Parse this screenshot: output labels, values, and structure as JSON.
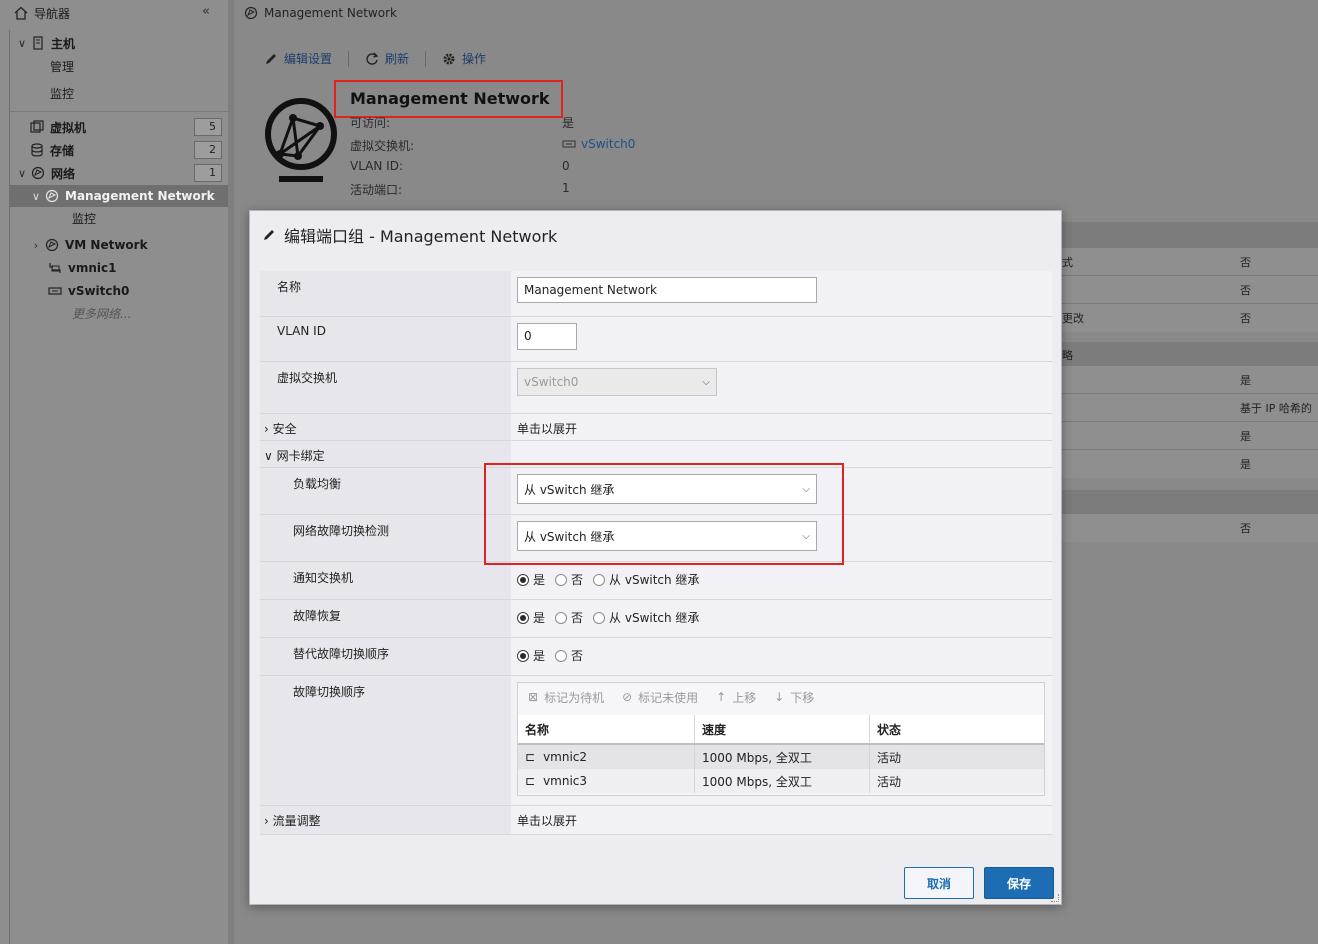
{
  "navigator": {
    "title": "导航器",
    "host": "主机",
    "host_manage": "管理",
    "host_monitor": "监控",
    "vms": "虚拟机",
    "vms_count": "5",
    "storage": "存储",
    "storage_count": "2",
    "network": "网络",
    "network_count": "1",
    "mgmt_network": "Management Network",
    "mgmt_monitor": "监控",
    "vm_network": "VM Network",
    "vmnic1": "vmnic1",
    "vswitch0": "vSwitch0",
    "more": "更多网络..."
  },
  "breadcrumb": "Management Network",
  "toolbar": {
    "edit": "编辑设置",
    "refresh": "刷新",
    "actions": "操作"
  },
  "summary": {
    "title": "Management Network",
    "accessible_label": "可访问:",
    "accessible_value": "是",
    "vswitch_label": "虚拟交换机:",
    "vswitch_value": "vSwitch0",
    "vlan_label": "VLAN ID:",
    "vlan_value": "0",
    "ports_label": "活动端口:",
    "ports_value": "1"
  },
  "right_panel": {
    "r1_l": "式",
    "r1_v": "否",
    "r2_v": "否",
    "r3_l": "更改",
    "r3_v": "否",
    "r4_l": "略",
    "r5_v": "是",
    "r6_v": "基于 IP 哈希的",
    "r7_v": "是",
    "r8_v": "是",
    "r9_v": "否"
  },
  "modal": {
    "title": "编辑端口组 - Management Network",
    "name_label": "名称",
    "name_value": "Management Network",
    "vlan_label": "VLAN ID",
    "vlan_value": "0",
    "vswitch_label": "虚拟交换机",
    "vswitch_value": "vSwitch0",
    "security_label": "安全",
    "security_value": "单击以展开",
    "teaming_label": "网卡绑定",
    "lb_label": "负载均衡",
    "lb_value": "从 vSwitch 继承",
    "fd_label": "网络故障切换检测",
    "fd_value": "从 vSwitch 继承",
    "notify_label": "通知交换机",
    "failback_label": "故障恢复",
    "override_label": "替代故障切换顺序",
    "opt_yes": "是",
    "opt_no": "否",
    "opt_inherit": "从 vSwitch 继承",
    "order_label": "故障切换顺序",
    "tb_standby": "标记为待机",
    "tb_unused": "标记未使用",
    "tb_up": "上移",
    "tb_down": "下移",
    "col_name": "名称",
    "col_speed": "速度",
    "col_status": "状态",
    "rows": [
      {
        "name": "vmnic2",
        "speed": "1000 Mbps, 全双工",
        "status": "活动"
      },
      {
        "name": "vmnic3",
        "speed": "1000 Mbps, 全双工",
        "status": "活动"
      }
    ],
    "shaping_label": "流量调整",
    "shaping_value": "单击以展开",
    "cancel": "取消",
    "save": "保存"
  }
}
